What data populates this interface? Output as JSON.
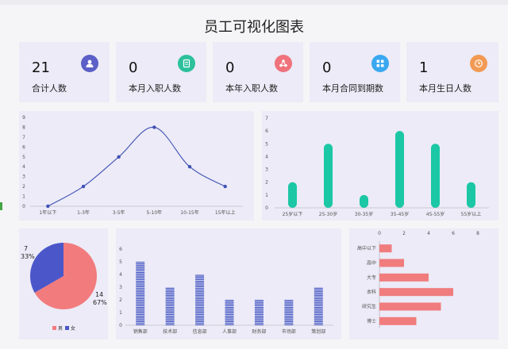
{
  "header": {
    "title": "员工可视化图表"
  },
  "stats": [
    {
      "value": "21",
      "label": "合计人数",
      "icon": "users-icon",
      "color": "#5b5fc7"
    },
    {
      "value": "0",
      "label": "本月入职人数",
      "icon": "document-icon",
      "color": "#2cc09c"
    },
    {
      "value": "0",
      "label": "本年入职人数",
      "icon": "nodes-icon",
      "color": "#f0727c"
    },
    {
      "value": "0",
      "label": "本月合同到期数",
      "icon": "grid-icon",
      "color": "#3aa8f0"
    },
    {
      "value": "1",
      "label": "本月生日人数",
      "icon": "clock-icon",
      "color": "#f29a54"
    }
  ],
  "chart_data": [
    {
      "type": "line",
      "categories": [
        "1年以下",
        "1-3年",
        "3-5年",
        "5-10年",
        "10-15年",
        "15年以上"
      ],
      "values": [
        0,
        2,
        5,
        8,
        4,
        2
      ],
      "ylim": [
        0,
        9
      ],
      "yticks": [
        "0",
        "1",
        "2",
        "3",
        "4",
        "5",
        "6",
        "7",
        "8",
        "9"
      ],
      "color": "#3f51b5"
    },
    {
      "type": "bar",
      "categories": [
        "25岁以下",
        "25-30岁",
        "30-35岁",
        "35-45岁",
        "45-55岁",
        "55岁以上"
      ],
      "values": [
        2,
        5,
        1,
        6,
        5,
        2
      ],
      "ylim": [
        0,
        7
      ],
      "yticks": [
        "0",
        "1",
        "2",
        "3",
        "4",
        "5",
        "6",
        "7"
      ],
      "color": "#1cc7a5"
    },
    {
      "type": "pie",
      "slices": [
        {
          "name": "男",
          "value": 14,
          "percent": "67%",
          "color": "#f27b7d"
        },
        {
          "name": "女",
          "value": 7,
          "percent": "33%",
          "color": "#4b57c9"
        }
      ],
      "legend": "bottom"
    },
    {
      "type": "bar",
      "categories": [
        "销售部",
        "技术部",
        "信息部",
        "人事部",
        "财务部",
        "市场部",
        "策划部"
      ],
      "values": [
        5,
        3,
        4,
        2,
        2,
        2,
        3
      ],
      "ylim": [
        0,
        6
      ],
      "yticks": [
        "0",
        "1",
        "2",
        "3",
        "4",
        "5",
        "6"
      ],
      "color": "#3c4fc0"
    },
    {
      "type": "bar",
      "orientation": "horizontal",
      "categories": [
        "高中以下",
        "高中",
        "大专",
        "本科",
        "研究生",
        "博士"
      ],
      "values": [
        1,
        2,
        4,
        6,
        5,
        3
      ],
      "xlim": [
        0,
        8
      ],
      "xticks": [
        "0",
        "2",
        "4",
        "6",
        "8"
      ],
      "color": "#f07c7e"
    }
  ]
}
